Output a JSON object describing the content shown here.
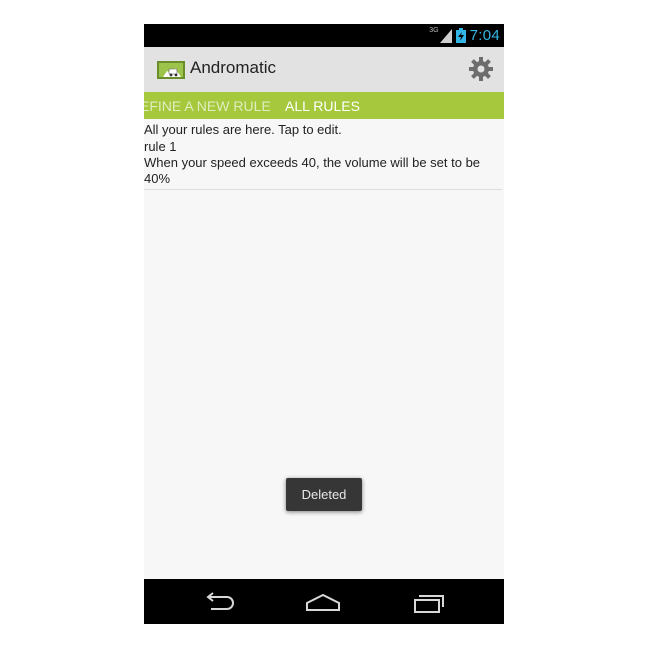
{
  "status_bar": {
    "network_type": "3G",
    "time": "7:04"
  },
  "action_bar": {
    "title": "Andromatic"
  },
  "tabs": [
    {
      "label": "EFINE A NEW RULE",
      "active": false
    },
    {
      "label": "ALL RULES",
      "active": true
    }
  ],
  "content": {
    "intro": "All your rules are here. Tap to edit.",
    "rules": [
      {
        "name": "rule 1",
        "description": "When your speed exceeds 40, the volume will be set to be 40%"
      }
    ]
  },
  "toast": {
    "text": "Deleted"
  },
  "nav": {
    "back_icon": "back-icon",
    "home_icon": "home-icon",
    "recent_icon": "recent-apps-icon"
  },
  "colors": {
    "accent": "#a5c83c",
    "status_text": "#33b5e5",
    "action_bar": "#e2e2e2"
  }
}
